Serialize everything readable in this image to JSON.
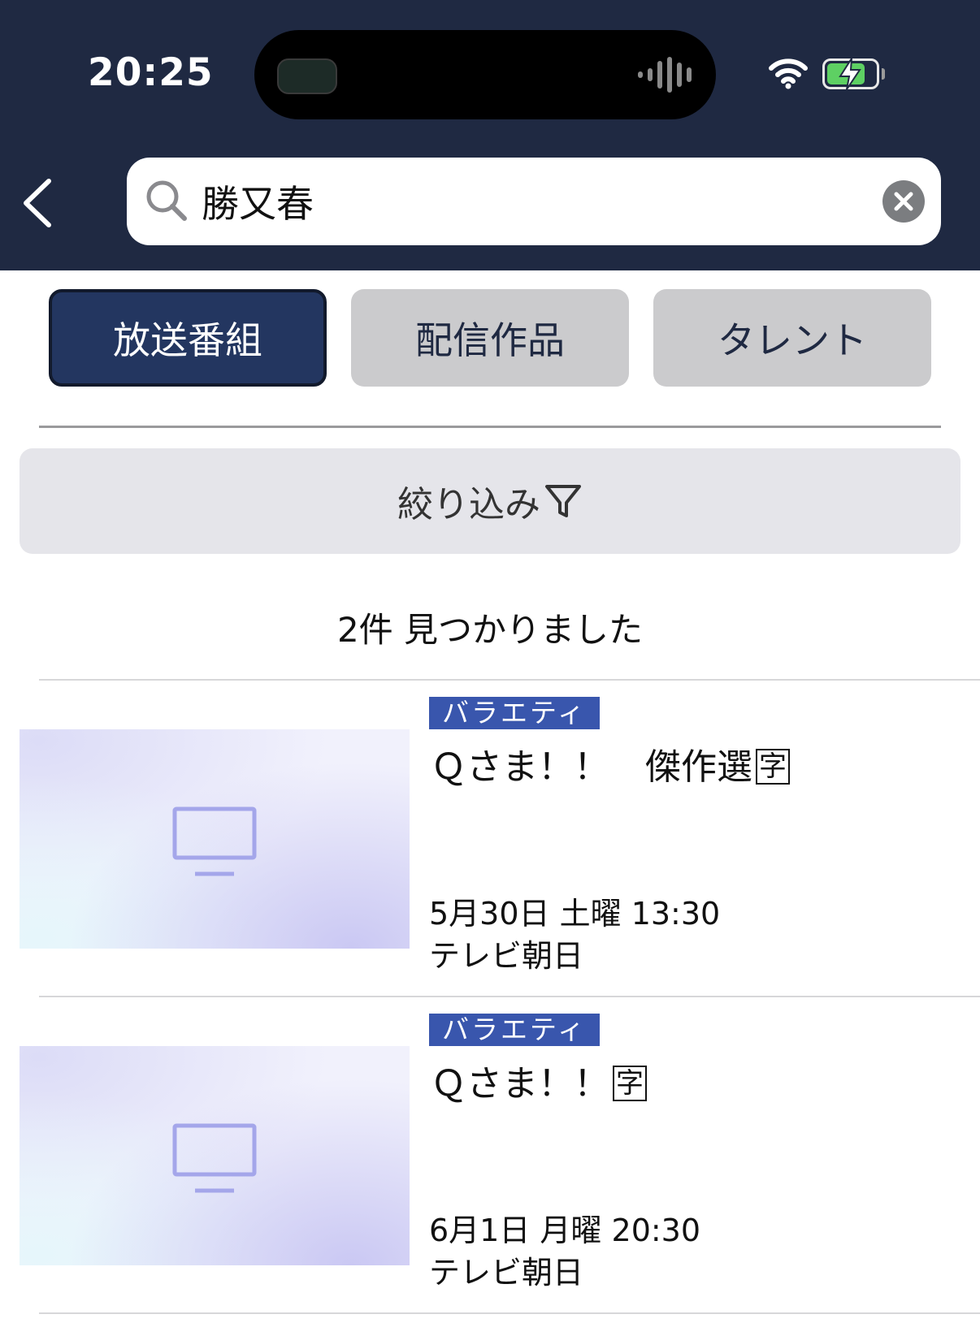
{
  "status_bar": {
    "time": "20:25"
  },
  "search": {
    "value": "勝又春"
  },
  "tabs": [
    {
      "label": "放送番組",
      "active": true
    },
    {
      "label": "配信作品",
      "active": false
    },
    {
      "label": "タレント",
      "active": false
    }
  ],
  "filter": {
    "label": "絞り込み"
  },
  "result_count": "2件 見つかりました",
  "results": [
    {
      "genre": "バラエティ",
      "title": "Ｑさま！！　傑作選",
      "badge": "字",
      "datetime": "5月30日 土曜 13:30",
      "station": "テレビ朝日"
    },
    {
      "genre": "バラエティ",
      "title": "Ｑさま！！",
      "badge": "字",
      "datetime": "6月1日 月曜 20:30",
      "station": "テレビ朝日"
    }
  ],
  "colors": {
    "header_bg": "#1f2942",
    "tab_active_bg": "#233660",
    "tab_inactive_bg": "#cbcbcd",
    "genre_bg": "#3956ad",
    "filter_bg": "#e5e5ea",
    "battery_fill": "#5ed063"
  },
  "icons": [
    "wifi-icon",
    "battery-charging-icon",
    "back-chevron-icon",
    "search-icon",
    "clear-icon",
    "filter-icon",
    "tv-icon"
  ],
  "battery_level": 0.8
}
